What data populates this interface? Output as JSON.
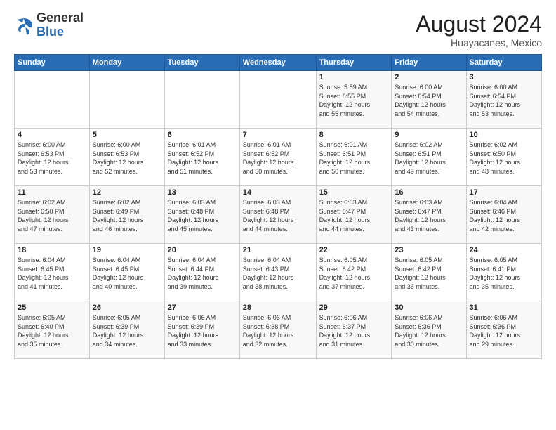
{
  "header": {
    "logo": {
      "line1": "General",
      "line2": "Blue"
    },
    "title": "August 2024",
    "subtitle": "Huayacanes, Mexico"
  },
  "days_of_week": [
    "Sunday",
    "Monday",
    "Tuesday",
    "Wednesday",
    "Thursday",
    "Friday",
    "Saturday"
  ],
  "weeks": [
    [
      {
        "day": "",
        "info": ""
      },
      {
        "day": "",
        "info": ""
      },
      {
        "day": "",
        "info": ""
      },
      {
        "day": "",
        "info": ""
      },
      {
        "day": "1",
        "info": "Sunrise: 5:59 AM\nSunset: 6:55 PM\nDaylight: 12 hours\nand 55 minutes."
      },
      {
        "day": "2",
        "info": "Sunrise: 6:00 AM\nSunset: 6:54 PM\nDaylight: 12 hours\nand 54 minutes."
      },
      {
        "day": "3",
        "info": "Sunrise: 6:00 AM\nSunset: 6:54 PM\nDaylight: 12 hours\nand 53 minutes."
      }
    ],
    [
      {
        "day": "4",
        "info": "Sunrise: 6:00 AM\nSunset: 6:53 PM\nDaylight: 12 hours\nand 53 minutes."
      },
      {
        "day": "5",
        "info": "Sunrise: 6:00 AM\nSunset: 6:53 PM\nDaylight: 12 hours\nand 52 minutes."
      },
      {
        "day": "6",
        "info": "Sunrise: 6:01 AM\nSunset: 6:52 PM\nDaylight: 12 hours\nand 51 minutes."
      },
      {
        "day": "7",
        "info": "Sunrise: 6:01 AM\nSunset: 6:52 PM\nDaylight: 12 hours\nand 50 minutes."
      },
      {
        "day": "8",
        "info": "Sunrise: 6:01 AM\nSunset: 6:51 PM\nDaylight: 12 hours\nand 50 minutes."
      },
      {
        "day": "9",
        "info": "Sunrise: 6:02 AM\nSunset: 6:51 PM\nDaylight: 12 hours\nand 49 minutes."
      },
      {
        "day": "10",
        "info": "Sunrise: 6:02 AM\nSunset: 6:50 PM\nDaylight: 12 hours\nand 48 minutes."
      }
    ],
    [
      {
        "day": "11",
        "info": "Sunrise: 6:02 AM\nSunset: 6:50 PM\nDaylight: 12 hours\nand 47 minutes."
      },
      {
        "day": "12",
        "info": "Sunrise: 6:02 AM\nSunset: 6:49 PM\nDaylight: 12 hours\nand 46 minutes."
      },
      {
        "day": "13",
        "info": "Sunrise: 6:03 AM\nSunset: 6:48 PM\nDaylight: 12 hours\nand 45 minutes."
      },
      {
        "day": "14",
        "info": "Sunrise: 6:03 AM\nSunset: 6:48 PM\nDaylight: 12 hours\nand 44 minutes."
      },
      {
        "day": "15",
        "info": "Sunrise: 6:03 AM\nSunset: 6:47 PM\nDaylight: 12 hours\nand 44 minutes."
      },
      {
        "day": "16",
        "info": "Sunrise: 6:03 AM\nSunset: 6:47 PM\nDaylight: 12 hours\nand 43 minutes."
      },
      {
        "day": "17",
        "info": "Sunrise: 6:04 AM\nSunset: 6:46 PM\nDaylight: 12 hours\nand 42 minutes."
      }
    ],
    [
      {
        "day": "18",
        "info": "Sunrise: 6:04 AM\nSunset: 6:45 PM\nDaylight: 12 hours\nand 41 minutes."
      },
      {
        "day": "19",
        "info": "Sunrise: 6:04 AM\nSunset: 6:45 PM\nDaylight: 12 hours\nand 40 minutes."
      },
      {
        "day": "20",
        "info": "Sunrise: 6:04 AM\nSunset: 6:44 PM\nDaylight: 12 hours\nand 39 minutes."
      },
      {
        "day": "21",
        "info": "Sunrise: 6:04 AM\nSunset: 6:43 PM\nDaylight: 12 hours\nand 38 minutes."
      },
      {
        "day": "22",
        "info": "Sunrise: 6:05 AM\nSunset: 6:42 PM\nDaylight: 12 hours\nand 37 minutes."
      },
      {
        "day": "23",
        "info": "Sunrise: 6:05 AM\nSunset: 6:42 PM\nDaylight: 12 hours\nand 36 minutes."
      },
      {
        "day": "24",
        "info": "Sunrise: 6:05 AM\nSunset: 6:41 PM\nDaylight: 12 hours\nand 35 minutes."
      }
    ],
    [
      {
        "day": "25",
        "info": "Sunrise: 6:05 AM\nSunset: 6:40 PM\nDaylight: 12 hours\nand 35 minutes."
      },
      {
        "day": "26",
        "info": "Sunrise: 6:05 AM\nSunset: 6:39 PM\nDaylight: 12 hours\nand 34 minutes."
      },
      {
        "day": "27",
        "info": "Sunrise: 6:06 AM\nSunset: 6:39 PM\nDaylight: 12 hours\nand 33 minutes."
      },
      {
        "day": "28",
        "info": "Sunrise: 6:06 AM\nSunset: 6:38 PM\nDaylight: 12 hours\nand 32 minutes."
      },
      {
        "day": "29",
        "info": "Sunrise: 6:06 AM\nSunset: 6:37 PM\nDaylight: 12 hours\nand 31 minutes."
      },
      {
        "day": "30",
        "info": "Sunrise: 6:06 AM\nSunset: 6:36 PM\nDaylight: 12 hours\nand 30 minutes."
      },
      {
        "day": "31",
        "info": "Sunrise: 6:06 AM\nSunset: 6:36 PM\nDaylight: 12 hours\nand 29 minutes."
      }
    ]
  ]
}
